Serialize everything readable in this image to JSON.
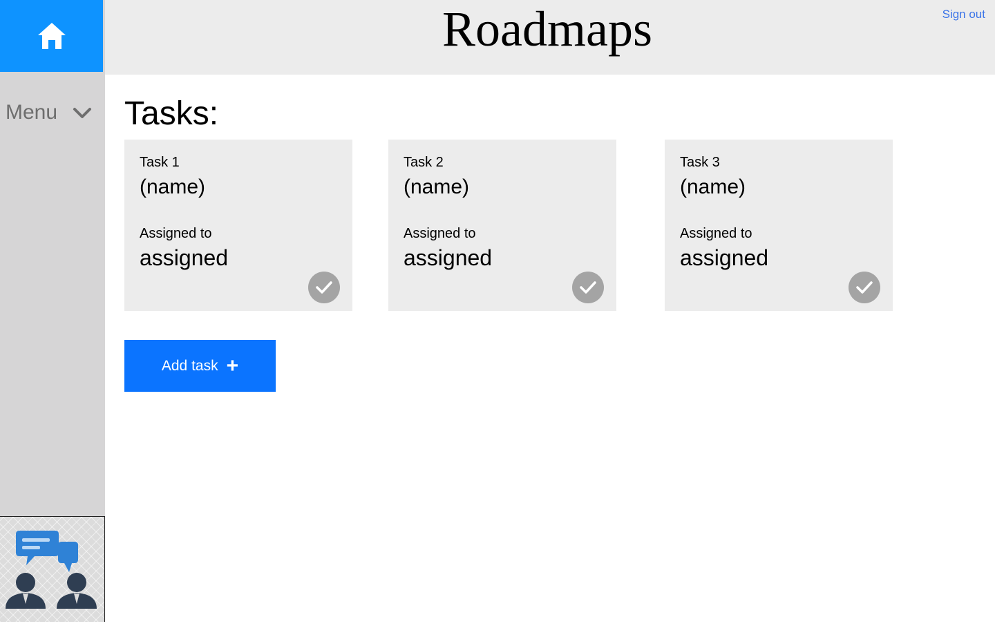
{
  "header": {
    "title": "Roadmaps",
    "sign_out_label": "Sign out"
  },
  "sidebar": {
    "home_icon": "home-icon",
    "menu_label": "Menu",
    "menu_icon": "chevron-down-icon",
    "logo_icon": "team-chat-icon"
  },
  "main": {
    "heading": "Tasks:",
    "tasks": [
      {
        "title": "Task 1",
        "name": "(name)",
        "assigned_label": "Assigned to",
        "assigned": "assigned",
        "complete_icon": "check-icon"
      },
      {
        "title": "Task 2",
        "name": "(name)",
        "assigned_label": "Assigned to",
        "assigned": "assigned",
        "complete_icon": "check-icon"
      },
      {
        "title": "Task 3",
        "name": "(name)",
        "assigned_label": "Assigned to",
        "assigned": "assigned",
        "complete_icon": "check-icon"
      }
    ],
    "add_task_label": "Add task",
    "add_task_icon": "plus-icon"
  },
  "colors": {
    "sidebar_bg": "#d6d5d6",
    "home_tile": "#0e93ff",
    "topbar_bg": "#ececec",
    "card_bg": "#ececec",
    "check_button": "#a4a4a4",
    "primary_button": "#0b74ff",
    "link": "#3b74e8"
  }
}
